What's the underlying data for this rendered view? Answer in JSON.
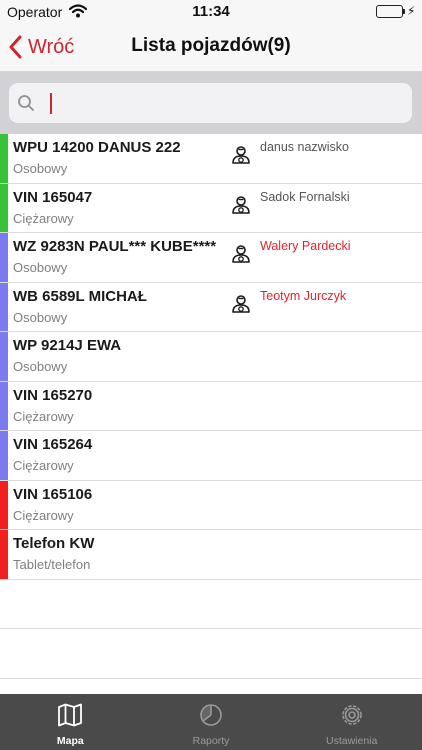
{
  "status_bar": {
    "carrier": "Operator",
    "time": "11:34",
    "battery_level": 1.0,
    "battery_color": "#36c23a"
  },
  "nav": {
    "back_label": "Wróć",
    "title": "Lista pojazdów(9)",
    "accent_color": "#d0252e"
  },
  "search": {
    "value": "",
    "placeholder": ""
  },
  "vehicles": [
    {
      "name": "WPU 14200 DANUS 222",
      "type": "Osobowy",
      "color": "#36c23a",
      "driver": "danus  nazwisko",
      "driver_alert": false
    },
    {
      "name": "VIN 165047",
      "type": "Ciężarowy",
      "color": "#36c23a",
      "driver": "Sadok Fornalski",
      "driver_alert": false
    },
    {
      "name": "WZ 9283N PAUL*** KUBE****",
      "type": "Osobowy",
      "color": "#7b7bf0",
      "driver": "Walery  Pardecki",
      "driver_alert": true
    },
    {
      "name": "WB 6589L MICHAŁ",
      "type": "Osobowy",
      "color": "#7b7bf0",
      "driver": "Teotym Jurczyk",
      "driver_alert": true
    },
    {
      "name": "WP 9214J EWA",
      "type": "Osobowy",
      "color": "#7b7bf0",
      "driver": "",
      "driver_alert": false
    },
    {
      "name": "VIN 165270",
      "type": "Ciężarowy",
      "color": "#7b7bf0",
      "driver": "",
      "driver_alert": false
    },
    {
      "name": "VIN 165264",
      "type": "Ciężarowy",
      "color": "#7b7bf0",
      "driver": "",
      "driver_alert": false
    },
    {
      "name": "VIN 165106",
      "type": "Ciężarowy",
      "color": "#f02020",
      "driver": "",
      "driver_alert": false
    },
    {
      "name": "Telefon KW",
      "type": "Tablet/telefon",
      "color": "#f02020",
      "driver": "",
      "driver_alert": false
    }
  ],
  "tabs": [
    {
      "label": "Mapa",
      "icon": "map-icon",
      "active": true
    },
    {
      "label": "Raporty",
      "icon": "reports-icon",
      "active": false
    },
    {
      "label": "Ustawienia",
      "icon": "gear-icon",
      "active": false
    }
  ]
}
